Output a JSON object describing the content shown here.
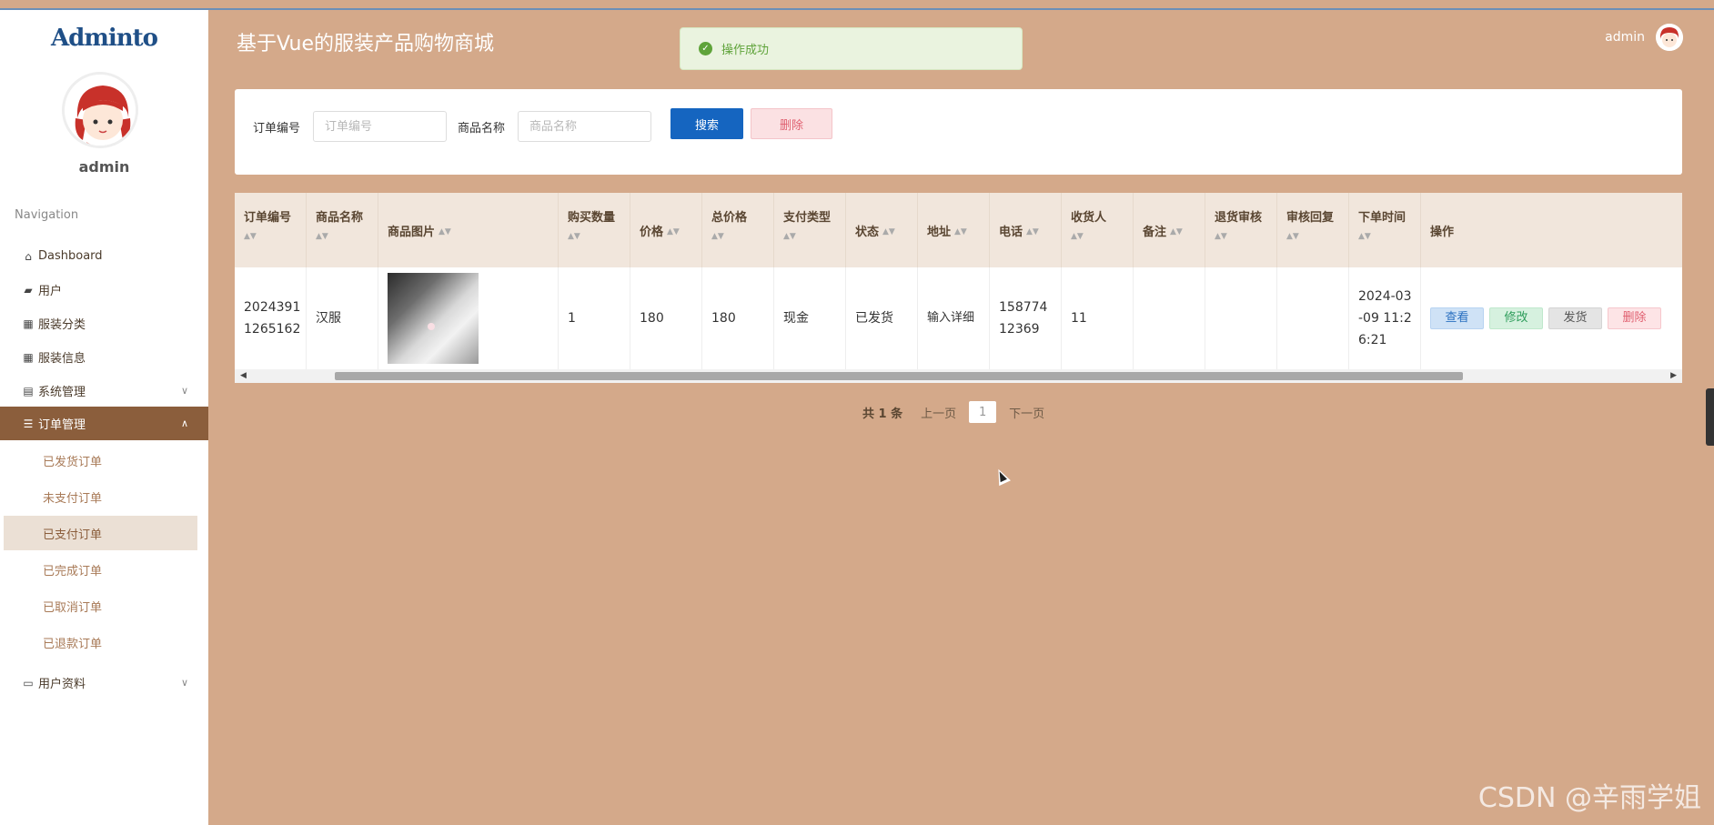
{
  "app": {
    "logo": "Adminto",
    "title": "基于Vue的服装产品购物商城",
    "user": "admin"
  },
  "toast": {
    "message": "操作成功"
  },
  "sidebar": {
    "username": "admin",
    "nav_title": "Navigation",
    "items": [
      {
        "label": "Dashboard",
        "icon": "home-icon"
      },
      {
        "label": "用户",
        "icon": "ticket-icon"
      },
      {
        "label": "服装分类",
        "icon": "grid-icon"
      },
      {
        "label": "服装信息",
        "icon": "grid-icon"
      },
      {
        "label": "系统管理",
        "icon": "clipboard-icon"
      },
      {
        "label": "订单管理",
        "icon": "sliders-icon"
      },
      {
        "label": "用户资料",
        "icon": "card-icon"
      }
    ],
    "order_sub": [
      "已发货订单",
      "未支付订单",
      "已支付订单",
      "已完成订单",
      "已取消订单",
      "已退款订单"
    ],
    "active_item": "订单管理",
    "selected_sub": "已支付订单"
  },
  "search": {
    "order_no_label": "订单编号",
    "order_no_placeholder": "订单编号",
    "product_label": "商品名称",
    "product_placeholder": "商品名称",
    "search_btn": "搜索",
    "delete_btn": "删除"
  },
  "table": {
    "headers": [
      "订单编号",
      "商品名称",
      "商品图片",
      "购买数量",
      "价格",
      "总价格",
      "支付类型",
      "状态",
      "地址",
      "电话",
      "收货人",
      "备注",
      "退货审核",
      "审核回复",
      "下单时间",
      "操作"
    ],
    "rows": [
      {
        "order_no": "20243911265162",
        "product": "汉服",
        "qty": "1",
        "price": "180",
        "total": "180",
        "pay_type": "现金",
        "status": "已发货",
        "address": "输入详细",
        "phone": "15877412369",
        "receiver": "11",
        "remark": "",
        "return_audit": "",
        "audit_reply": "",
        "order_time": "2024-03-09 11:26:21"
      }
    ],
    "ops": {
      "view": "查看",
      "edit": "修改",
      "ship": "发货",
      "delete": "删除"
    }
  },
  "pager": {
    "total": "共 1 条",
    "prev": "上一页",
    "current": "1",
    "next": "下一页"
  },
  "watermark": "CSDN @辛雨学姐",
  "colors": {
    "sidebar_active": "#8b5e3c",
    "background": "#d4a98a",
    "primary": "#1565c0"
  }
}
